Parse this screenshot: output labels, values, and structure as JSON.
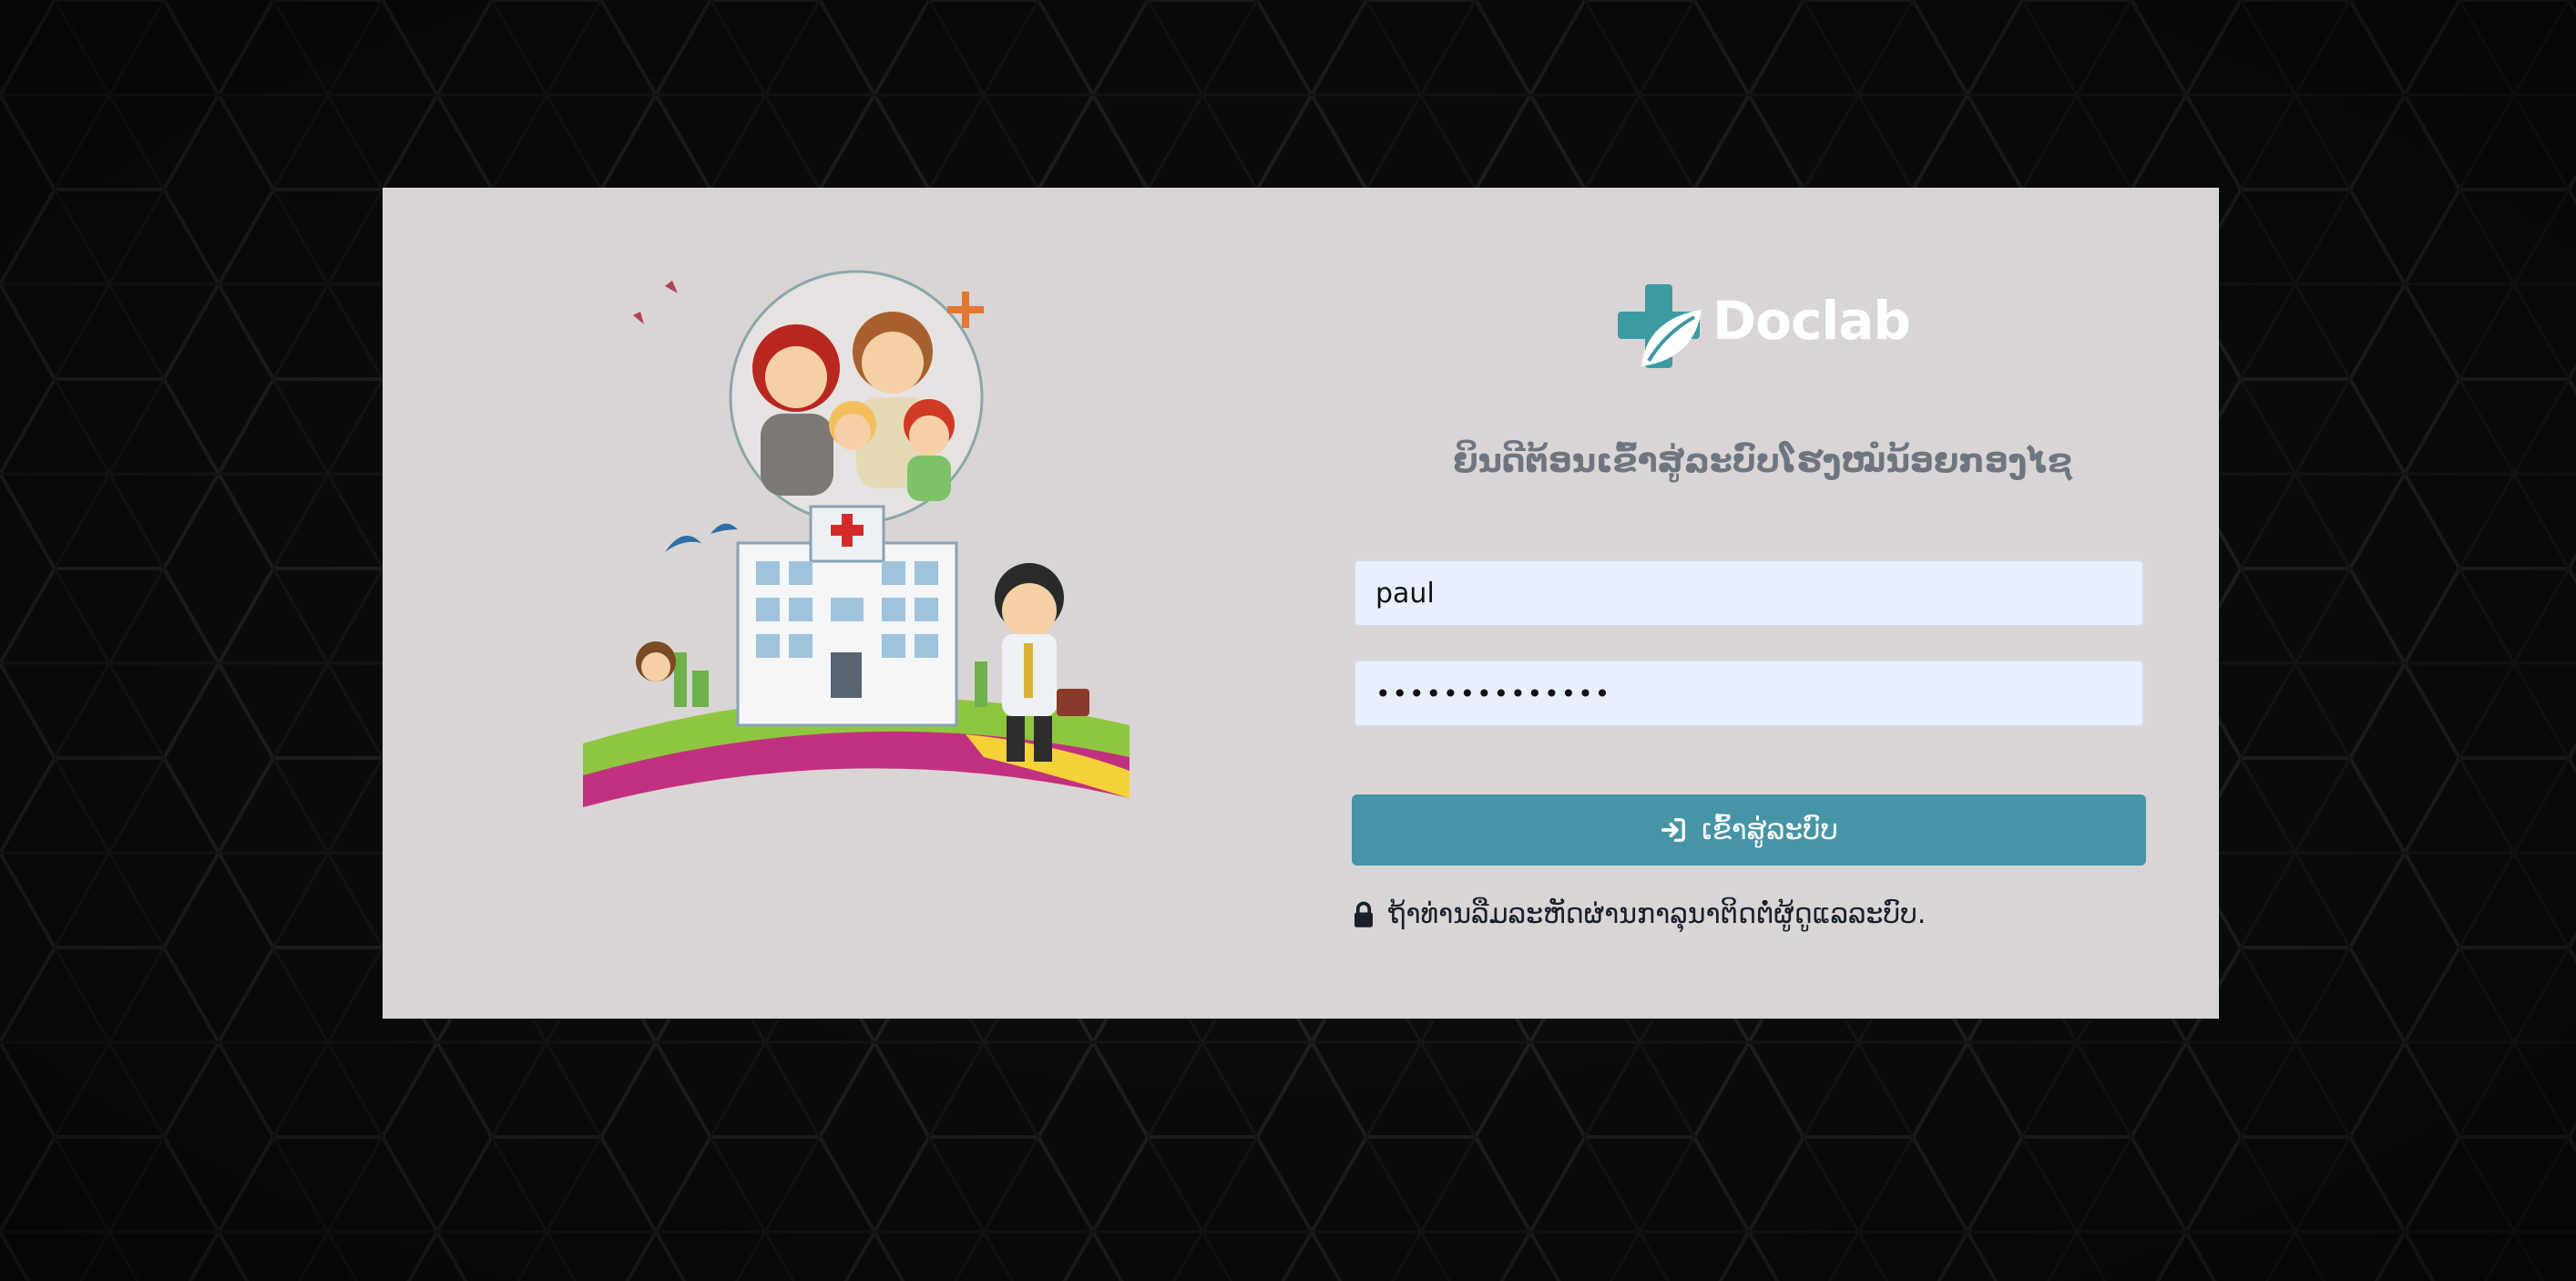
{
  "brand": {
    "name": "Doclab",
    "accent": "#3b9aa3"
  },
  "login": {
    "welcome": "ຍິນດີຕ້ອນເຂົ້າສູ່ລະບົບໂຮງໝໍນ້ອຍກອງໄຊ",
    "username_value": "paul",
    "password_mask": "••••••••••••••",
    "submit_label": "ເຂົ້າສູ່ລະບົບ",
    "submit_icon": "sign-in-icon",
    "forgot_text": "ຖ້າທ່ານລືມລະຫັດຜ່ານກາລຸນາຕິດຕໍ່ຜູ້ດູແລລະບົບ.",
    "forgot_icon": "lock-icon"
  },
  "colors": {
    "card_bg": "#d9d5d4",
    "button_bg": "#4695a6",
    "input_bg": "#e8f0fe",
    "page_bg": "#0b0b0b"
  }
}
